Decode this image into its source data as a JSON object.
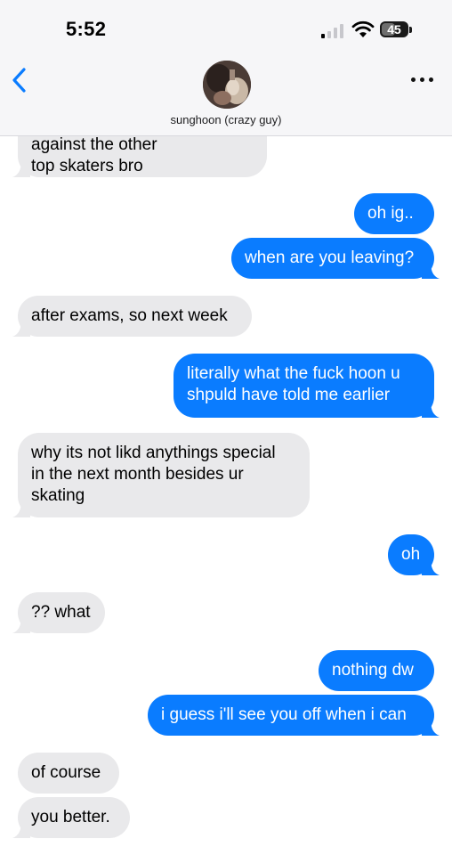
{
  "status_bar": {
    "time": "5:52",
    "battery": "45",
    "signal_icon": "cellular-signal-icon",
    "wifi_icon": "wifi-icon",
    "battery_icon": "battery-icon"
  },
  "header": {
    "back_icon": "chevron-left-icon",
    "contact_name": "sunghoon (crazy guy)",
    "more_icon": "ellipsis-icon"
  },
  "colors": {
    "sent_bubble": "#0a7cff",
    "received_bubble": "#e9e9eb",
    "accent": "#0a7cff"
  },
  "messages": [
    {
      "from": "them",
      "text": "against the other\ntop skaters bro"
    },
    {
      "from": "me",
      "text": "oh ig.."
    },
    {
      "from": "me",
      "text": "when are you leaving?"
    },
    {
      "from": "them",
      "text": "after exams, so next week"
    },
    {
      "from": "me",
      "text": "literally what the fuck hoon u\nshpuld have told me earlier"
    },
    {
      "from": "them",
      "text": "why its not likd anythings special\nin the next month besides ur\nskating"
    },
    {
      "from": "me",
      "text": "oh"
    },
    {
      "from": "them",
      "text": "?? what"
    },
    {
      "from": "me",
      "text": "nothing dw"
    },
    {
      "from": "me",
      "text": "i guess i'll see you off when i can"
    },
    {
      "from": "them",
      "text": "of course"
    },
    {
      "from": "them",
      "text": "you better."
    }
  ]
}
